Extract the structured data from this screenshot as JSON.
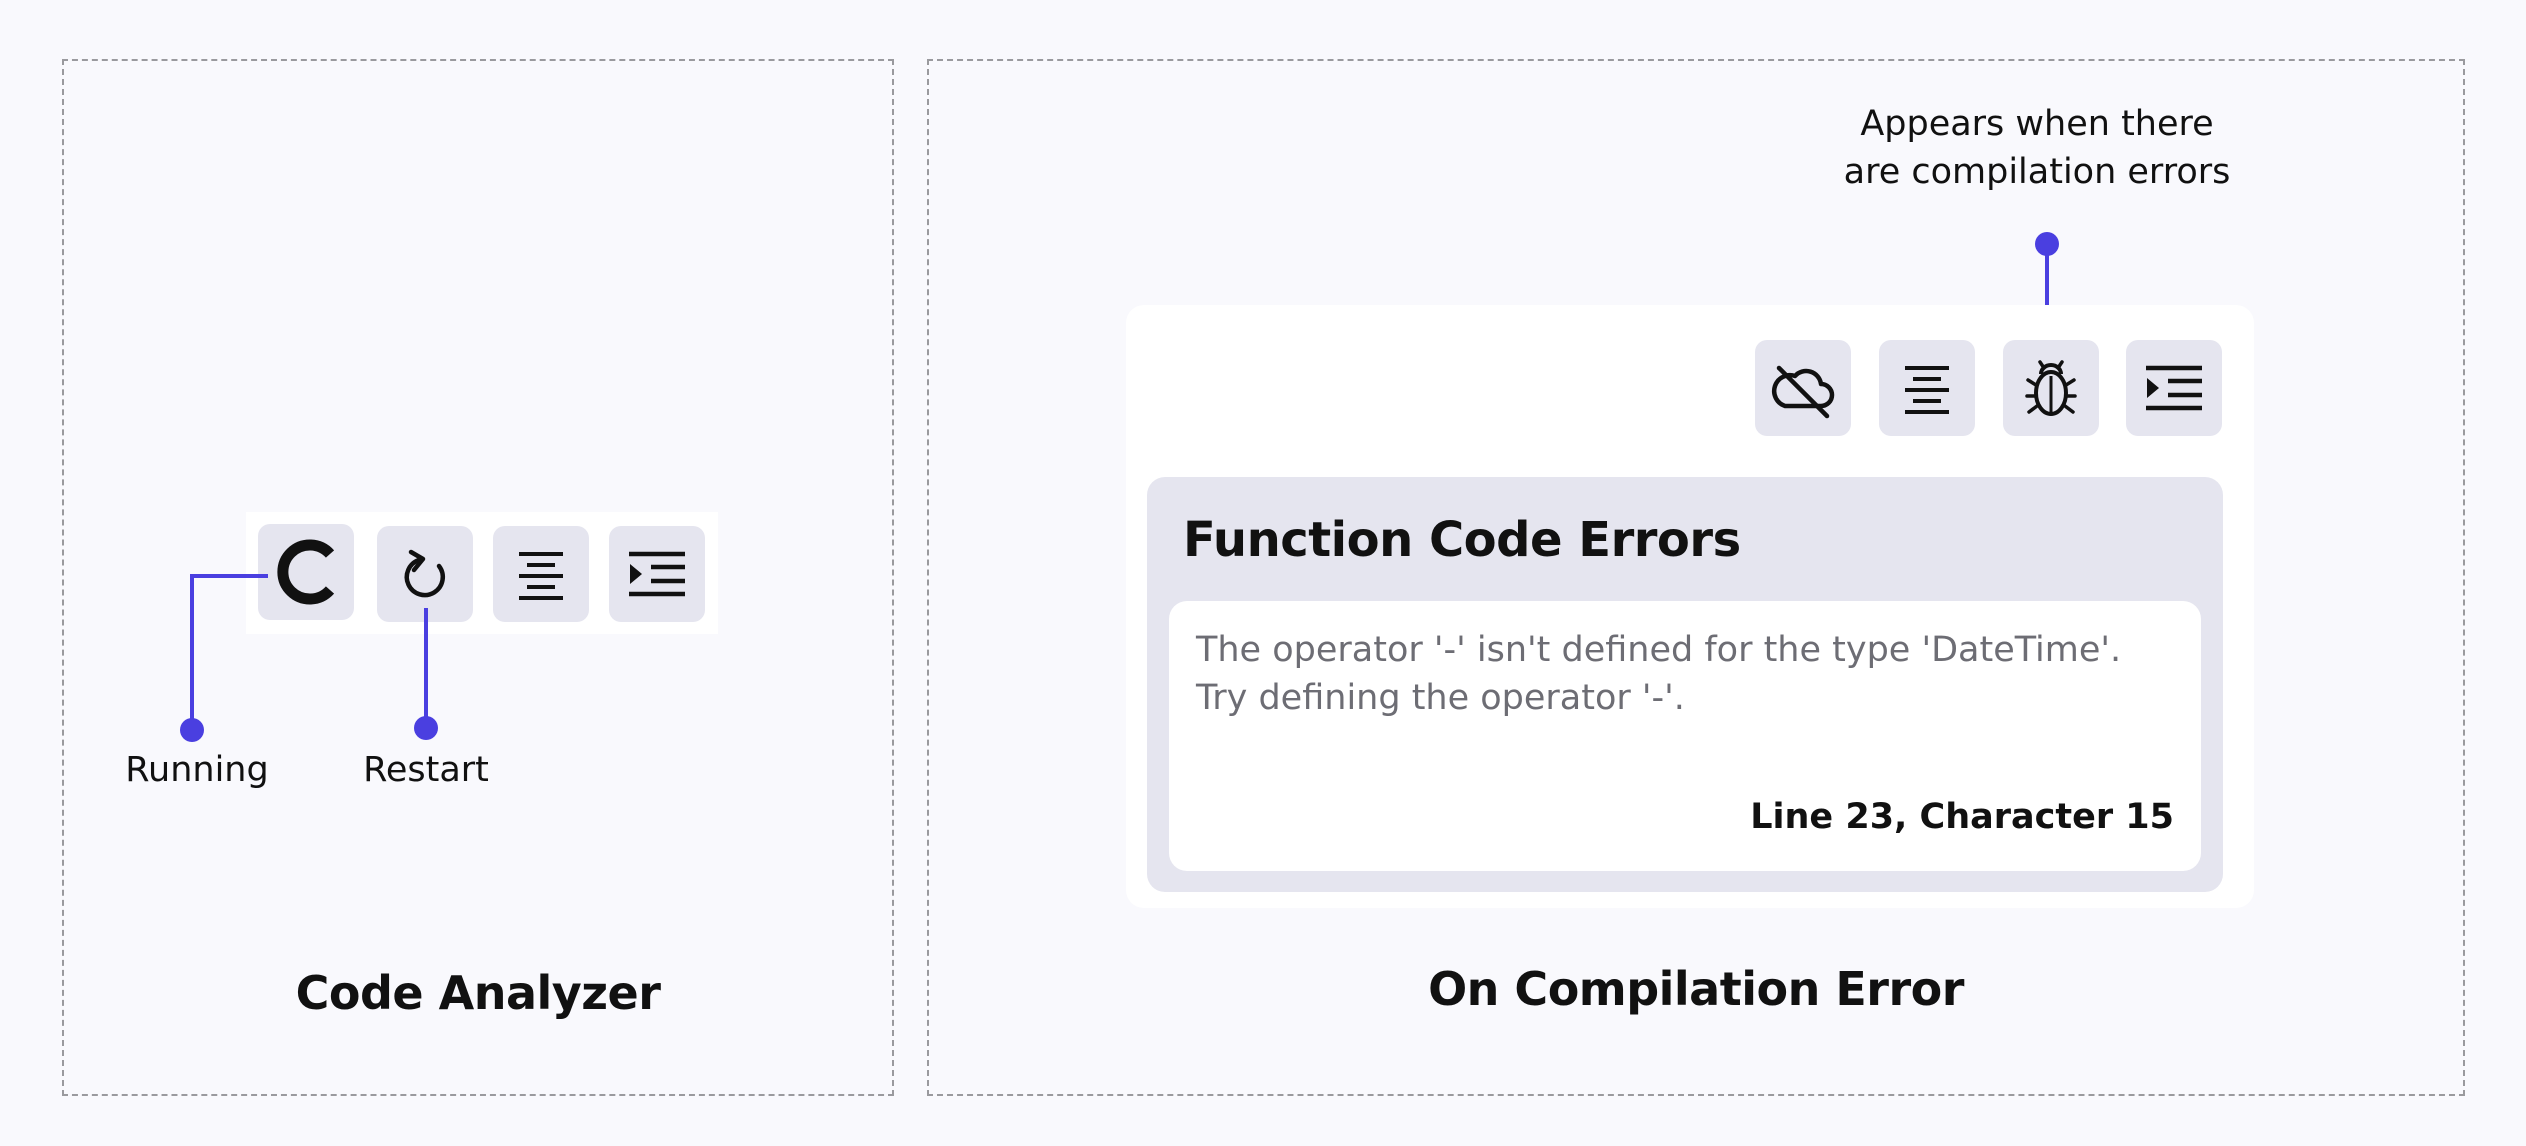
{
  "code_analyzer": {
    "title": "Code Analyzer",
    "buttons": [
      {
        "name": "running",
        "icon": "loading-spinner-icon"
      },
      {
        "name": "restart",
        "icon": "restart-icon"
      },
      {
        "name": "format",
        "icon": "align-center-icon"
      },
      {
        "name": "indent",
        "icon": "indent-icon"
      }
    ],
    "labels": {
      "running": "Running",
      "restart": "Restart"
    }
  },
  "compilation_error": {
    "title": "On Compilation Error",
    "callout": "Appears when there are compilation errors",
    "callout_line1": "Appears when there",
    "callout_line2": "are compilation errors",
    "buttons": [
      {
        "name": "offline",
        "icon": "cloud-off-icon"
      },
      {
        "name": "format",
        "icon": "align-center-icon"
      },
      {
        "name": "errors",
        "icon": "bug-icon"
      },
      {
        "name": "indent",
        "icon": "indent-icon"
      }
    ],
    "error_panel": {
      "title": "Function Code Errors",
      "message": "The operator '-' isn't defined for the type 'DateTime'. Try defining the operator '-'.",
      "location": "Line 23, Character 15"
    }
  },
  "colors": {
    "background": "#F9F9FD",
    "accent": "#4A3FE0",
    "button_bg": "#E5E5EF",
    "muted_text": "#6D6D74"
  }
}
